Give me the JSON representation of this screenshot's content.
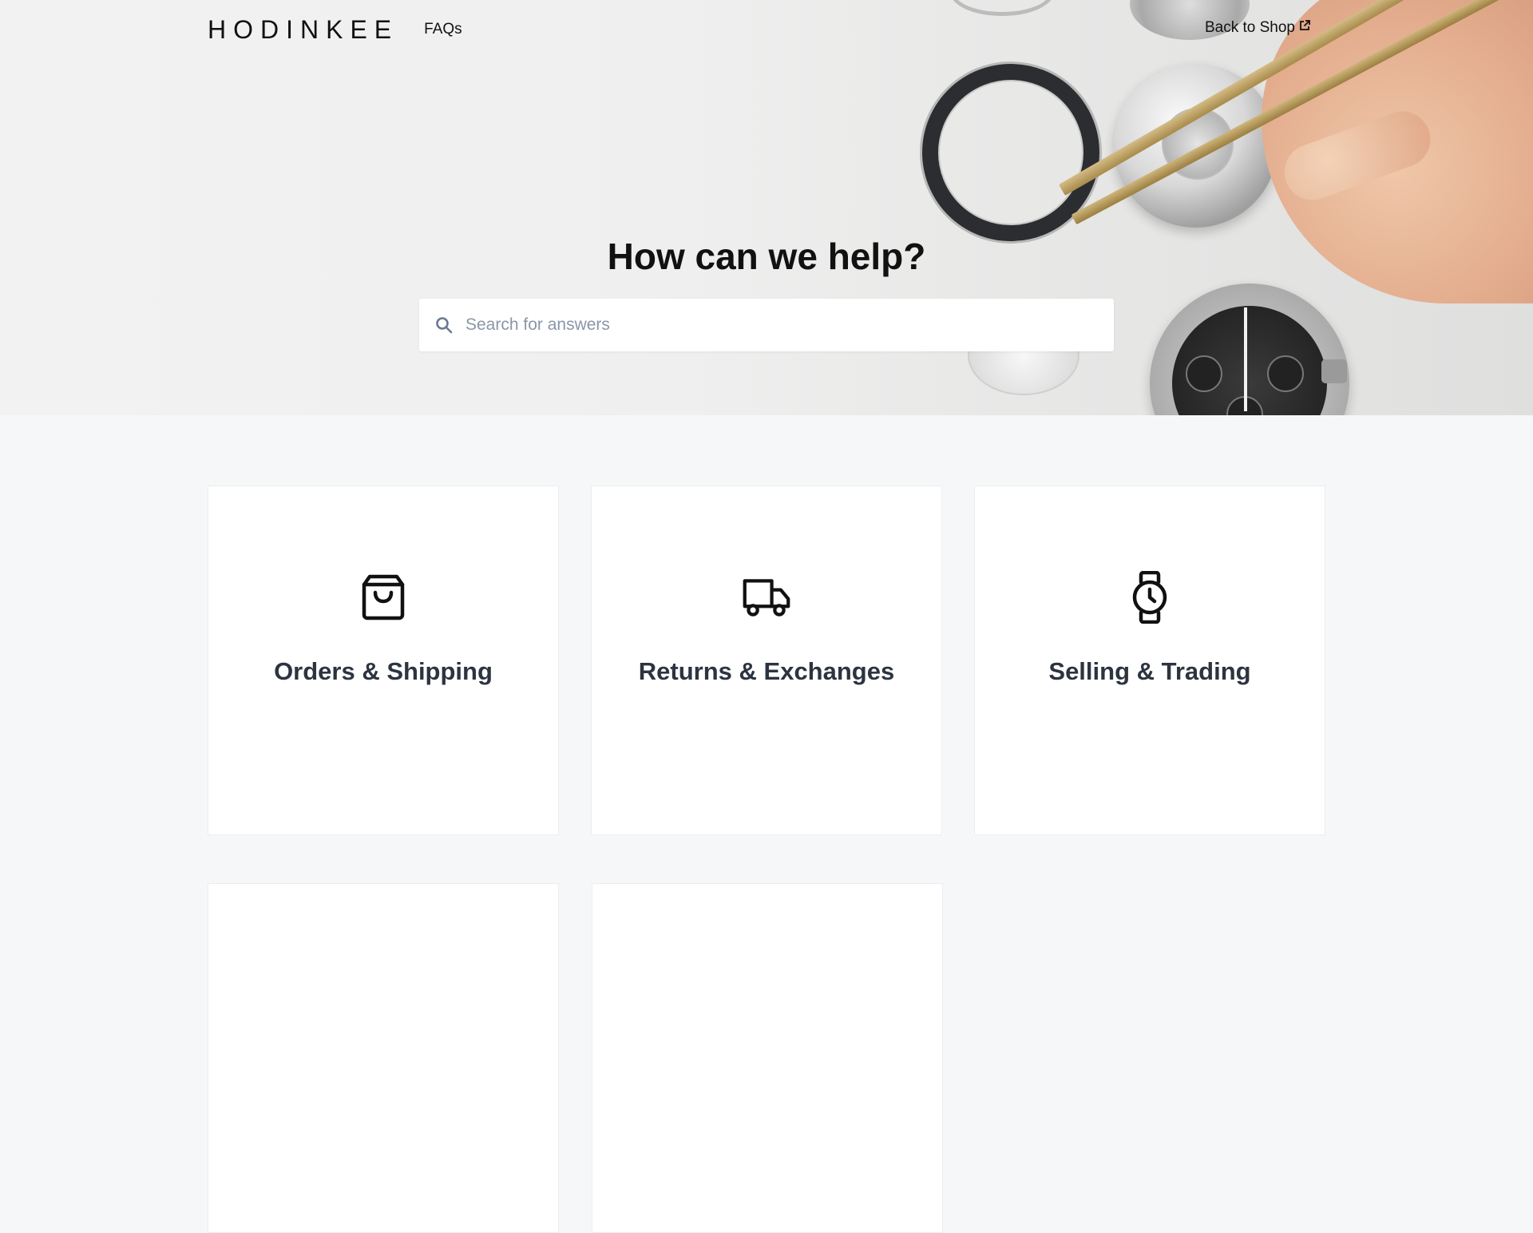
{
  "header": {
    "logo": "HODINKEE",
    "nav_faqs": "FAQs",
    "back_to_shop": "Back to Shop"
  },
  "hero": {
    "title": "How can we help?",
    "search": {
      "placeholder": "Search for answers",
      "value": ""
    }
  },
  "categories": [
    {
      "label": "Orders & Shipping",
      "icon": "shopping-bag-icon"
    },
    {
      "label": "Returns & Exchanges",
      "icon": "truck-icon"
    },
    {
      "label": "Selling & Trading",
      "icon": "watch-icon"
    },
    {
      "label": "",
      "icon": ""
    },
    {
      "label": "",
      "icon": ""
    }
  ]
}
